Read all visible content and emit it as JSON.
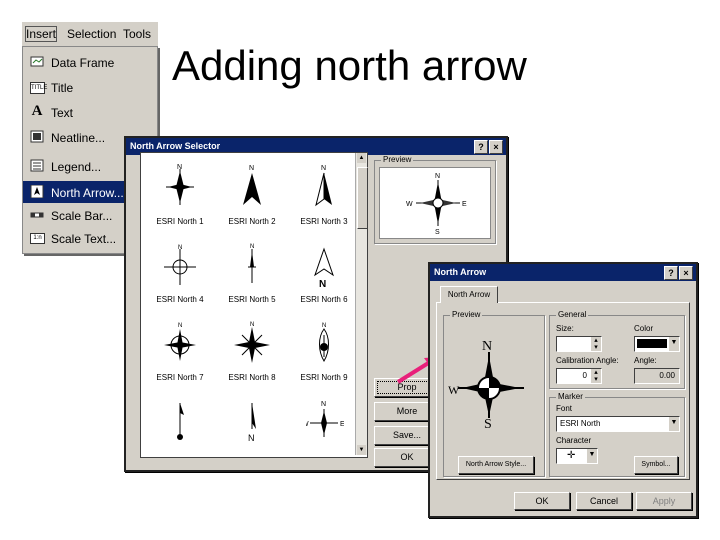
{
  "slide": {
    "title": "Adding north arrow"
  },
  "menubar": {
    "items": [
      "Insert",
      "Selection",
      "Tools"
    ]
  },
  "insert_menu": {
    "items": [
      {
        "label": "Data Frame",
        "icon": "data-frame-icon"
      },
      {
        "label": "Title",
        "icon": "title-icon",
        "icon_text": "TITLE"
      },
      {
        "label": "Text",
        "icon": "text-icon",
        "icon_text": "A"
      },
      {
        "label": "Neatline...",
        "icon": "neatline-icon"
      },
      {
        "label": "Legend...",
        "icon": "legend-icon"
      },
      {
        "label": "North Arrow...",
        "icon": "north-arrow-icon",
        "highlighted": true
      },
      {
        "label": "Scale Bar...",
        "icon": "scale-bar-icon"
      },
      {
        "label": "Scale Text...",
        "icon": "scale-text-icon",
        "icon_text": "1:n"
      }
    ]
  },
  "selector_dialog": {
    "title": "North Arrow Selector",
    "help": "?",
    "close": "×",
    "preview_label": "Preview",
    "preview_letters": {
      "n": "N",
      "s": "S",
      "w": "W",
      "e": "E"
    },
    "arrows": [
      {
        "caption": "ESRI North 1"
      },
      {
        "caption": "ESRI North 2"
      },
      {
        "caption": "ESRI North 3"
      },
      {
        "caption": "ESRI North 4"
      },
      {
        "caption": "ESRI North 5"
      },
      {
        "caption": "ESRI North 6"
      },
      {
        "caption": "ESRI North 7"
      },
      {
        "caption": "ESRI North 8"
      },
      {
        "caption": "ESRI North 9"
      }
    ],
    "letters": {
      "n": "N",
      "s": "S",
      "w": "W",
      "e": "E"
    },
    "buttons": [
      "Prop",
      "More",
      "Save...",
      "OK"
    ]
  },
  "props_dialog": {
    "title": "North Arrow",
    "help": "?",
    "close": "×",
    "tab": "North Arrow",
    "preview_label": "Preview",
    "preview_letters": {
      "n": "N",
      "s": "S",
      "w": "W",
      "e": "E"
    },
    "general_label": "General",
    "size_label": "Size:",
    "size_value": "",
    "color_label": "Color",
    "calibration_label": "Calibration Angle:",
    "calibration_value": "0",
    "angle_label": "Angle:",
    "angle_value": "0.00",
    "marker_label": "Marker",
    "font_label": "Font",
    "font_value": "ESRI North",
    "character_label": "Character",
    "character_value": "✛",
    "style_button": "North Arrow Style...",
    "symbol_button": "Symbol...",
    "ok_button": "OK",
    "cancel_button": "Cancel",
    "apply_button": "Apply"
  },
  "colors": {
    "titlebar": "#0a246a",
    "dialog": "#d4d0c8",
    "pointer": "#e8207a",
    "color_swatch": "#000000"
  }
}
